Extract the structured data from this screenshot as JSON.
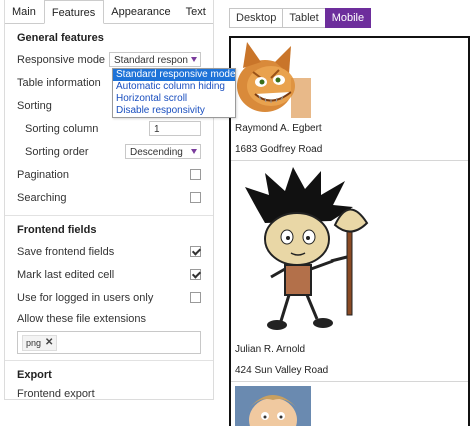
{
  "tabs": [
    "Main",
    "Features",
    "Appearance",
    "Text"
  ],
  "general": {
    "title": "General features",
    "responsive_mode_label": "Responsive mode",
    "responsive_mode_value": "Standard respon",
    "table_information_label": "Table information",
    "sorting_label": "Sorting",
    "sorting_column_label": "Sorting column",
    "sorting_column_value": "1",
    "sorting_order_label": "Sorting order",
    "sorting_order_value": "Descending",
    "pagination_label": "Pagination",
    "pagination_checked": false,
    "searching_label": "Searching",
    "searching_checked": false
  },
  "dropdown_options": [
    "Standard responsive mode",
    "Automatic column hiding",
    "Horizontal scroll",
    "Disable responsivity"
  ],
  "frontend": {
    "title": "Frontend fields",
    "save_fields_label": "Save frontend fields",
    "save_fields_checked": true,
    "mark_edited_label": "Mark last edited cell",
    "mark_edited_checked": true,
    "logged_in_label": "Use for logged in users only",
    "logged_in_checked": false,
    "extensions_label": "Allow these file extensions",
    "extension_tag": "png"
  },
  "export": {
    "title": "Export",
    "frontend_export_label": "Frontend export"
  },
  "device_tabs": [
    "Desktop",
    "Tablet",
    "Mobile"
  ],
  "active_device": "Mobile",
  "records": [
    {
      "name": "Raymond A. Egbert",
      "address": "1683 Godfrey Road",
      "image": "cat-avatar"
    },
    {
      "name": "Julian R. Arnold",
      "address": "424 Sun Valley Road",
      "image": "cartoon-character-avatar"
    },
    {
      "image": "cartoon-boy-avatar"
    }
  ],
  "colors": {
    "accent": "#6d2e9c",
    "selection": "#1e73d8"
  }
}
